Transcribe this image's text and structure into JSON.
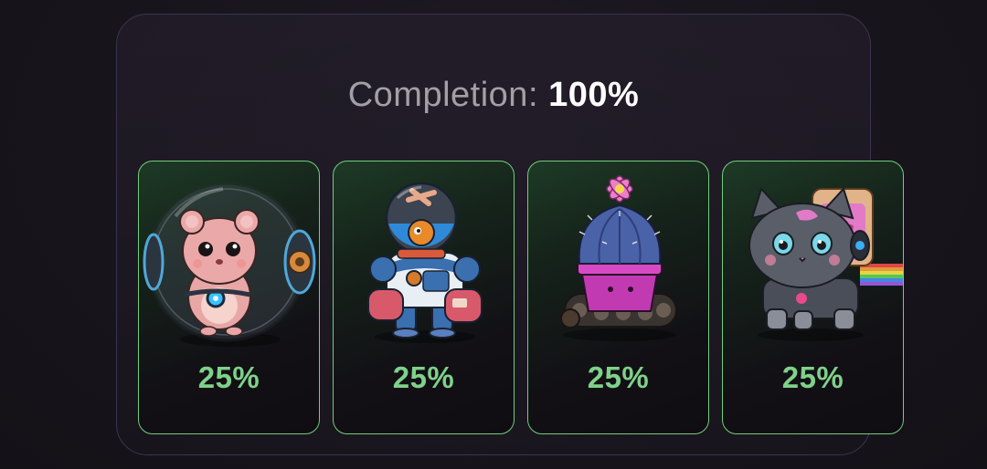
{
  "header": {
    "completion_label": "Completion:",
    "completion_value": "100%"
  },
  "cards": [
    {
      "character": "hamster-in-ball-icon",
      "percent": "25%"
    },
    {
      "character": "robot-fish-diver-icon",
      "percent": "25%"
    },
    {
      "character": "cactus-tank-icon",
      "percent": "25%"
    },
    {
      "character": "cat-toast-rainbow-icon",
      "percent": "25%"
    }
  ],
  "colors": {
    "accent_green": "#7fd18a",
    "card_border": "#6fcf7b",
    "panel_border": "#3a3550",
    "label_gray": "#a39fa8"
  }
}
